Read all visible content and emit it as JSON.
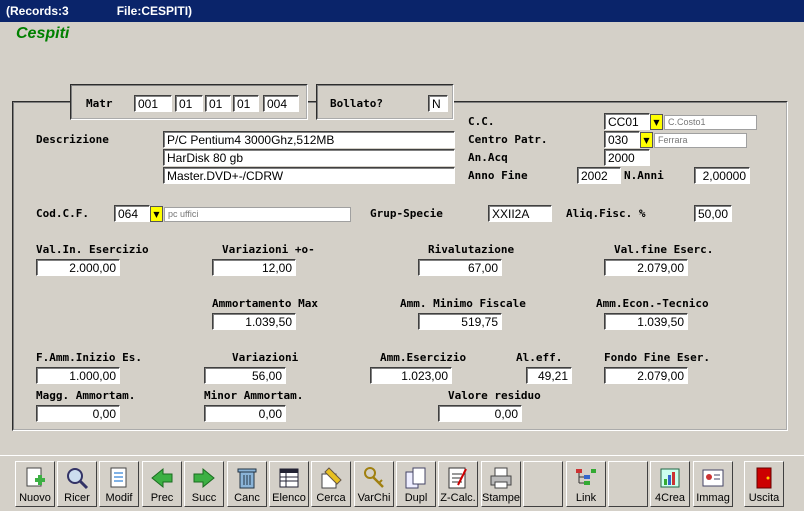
{
  "title_bar": {
    "records": "(Records:3",
    "file": "File:CESPITI)"
  },
  "app_title": "Cespiti",
  "matr": {
    "label": "Matr",
    "v1": "001",
    "v2": "01",
    "v3": "01",
    "v4": "01",
    "v5": "004"
  },
  "bollato": {
    "label": "Bollato?",
    "value": "N"
  },
  "descrizione": {
    "label": "Descrizione",
    "line1": "P/C Pentium4 3000Ghz,512MB",
    "line2": "HarDisk 80 gb",
    "line3": "Master.DVD+-/CDRW"
  },
  "cc": {
    "label": "C.C.",
    "value": "CC01",
    "hint": "C.Costo1"
  },
  "centro_patr": {
    "label": "Centro Patr.",
    "value": "030",
    "hint": "Ferrara"
  },
  "an_acq": {
    "label": "An.Acq",
    "value": "2000"
  },
  "anno_fine": {
    "label": "Anno Fine",
    "value": "2002"
  },
  "n_anni": {
    "label": "N.Anni",
    "value": "2,00000"
  },
  "cod_cf": {
    "label": "Cod.C.F.",
    "value": "064",
    "hint": "pc uffici"
  },
  "grup_specie": {
    "label": "Grup-Specie",
    "value": "XXII2A"
  },
  "aliq_fisc": {
    "label": "Aliq.Fisc. %",
    "value": "50,00"
  },
  "val_in_esercizio": {
    "label": "Val.In. Esercizio",
    "value": "2.000,00"
  },
  "variazioni_pm": {
    "label": "Variazioni +o-",
    "value": "12,00"
  },
  "rivalutazione": {
    "label": "Rivalutazione",
    "value": "67,00"
  },
  "val_fine_eserc": {
    "label": "Val.fine Eserc.",
    "value": "2.079,00"
  },
  "ammortamento_max": {
    "label": "Ammortamento Max",
    "value": "1.039,50"
  },
  "amm_minimo_fiscale": {
    "label": "Amm. Minimo Fiscale",
    "value": "519,75"
  },
  "amm_econ_tecnico": {
    "label": "Amm.Econ.-Tecnico",
    "value": "1.039,50"
  },
  "f_amm_inizio": {
    "label": "F.Amm.Inizio Es.",
    "value": "1.000,00"
  },
  "variazioni": {
    "label": "Variazioni",
    "value": "56,00"
  },
  "amm_esercizio": {
    "label": "Amm.Esercizio",
    "value": "1.023,00"
  },
  "al_eff": {
    "label": "Al.eff.",
    "value": "49,21"
  },
  "fondo_fine": {
    "label": "Fondo Fine Eser.",
    "value": "2.079,00"
  },
  "magg_ammortam": {
    "label": "Magg. Ammortam.",
    "value": "0,00"
  },
  "minor_ammortam": {
    "label": "Minor Ammortam.",
    "value": "0,00"
  },
  "valore_residuo": {
    "label": "Valore residuo",
    "value": "0,00"
  },
  "toolbar": {
    "nuovo": "Nuovo",
    "ricer": "Ricer",
    "modif": "Modif",
    "prec": "Prec",
    "succ": "Succ",
    "canc": "Canc",
    "elenco": "Elenco",
    "cerca": "Cerca",
    "varchi": "VarChi",
    "dupl": "Dupl",
    "zcalc": "Z-Calc.",
    "stampe": "Stampe",
    "link": "Link",
    "crea": "4Crea",
    "immag": "Immag",
    "uscita": "Uscita"
  },
  "colors": {
    "title_bar": "#0a246a",
    "app_title": "#008000",
    "dropdown": "#ffff00",
    "arrow_green": "#3cb043",
    "exit_red": "#cc0000"
  },
  "icons": {
    "dropdown": "chevron-down-icon",
    "nuovo": "new-document-icon",
    "ricer": "search-icon",
    "modif": "edit-document-icon",
    "prec": "arrow-left-icon",
    "succ": "arrow-right-icon",
    "canc": "trash-icon",
    "elenco": "list-table-icon",
    "cerca": "find-icon",
    "varchi": "keys-icon",
    "dupl": "copy-icon",
    "zcalc": "calculator-icon",
    "stampe": "printer-icon",
    "link": "link-tree-icon",
    "crea": "create-icon",
    "immag": "image-card-icon",
    "uscita": "exit-door-icon"
  }
}
